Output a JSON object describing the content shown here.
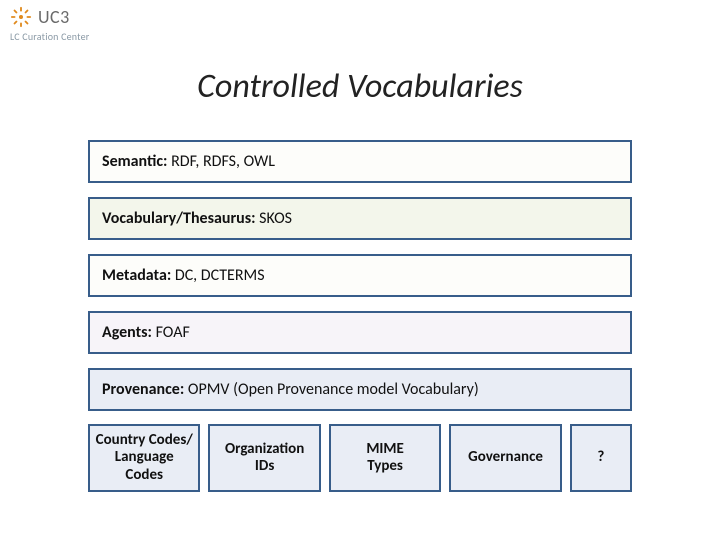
{
  "logo": {
    "text": "UC3",
    "subtitle": "LC Curation Center"
  },
  "title": "Controlled Vocabularies",
  "rows": [
    {
      "label": "Semantic:",
      "value": "RDF, RDFS, OWL"
    },
    {
      "label": "Vocabulary/Thesaurus:",
      "value": "SKOS"
    },
    {
      "label": "Metadata:",
      "value": "DC, DCTERMS"
    },
    {
      "label": "Agents:",
      "value": "FOAF"
    },
    {
      "label": "Provenance:",
      "value": "OPMV (Open Provenance model Vocabulary)"
    }
  ],
  "bottom": [
    "Country Codes/\nLanguage\nCodes",
    "Organization\nIDs",
    "MIME\nTypes",
    "Governance",
    "?"
  ],
  "colors": {
    "border": "#385d8a",
    "bg_blue": "#e9edf5",
    "bg_green": "#f3f6eb",
    "bg_purple": "#f7f4f9",
    "bg_plain": "#fdfdfa"
  }
}
